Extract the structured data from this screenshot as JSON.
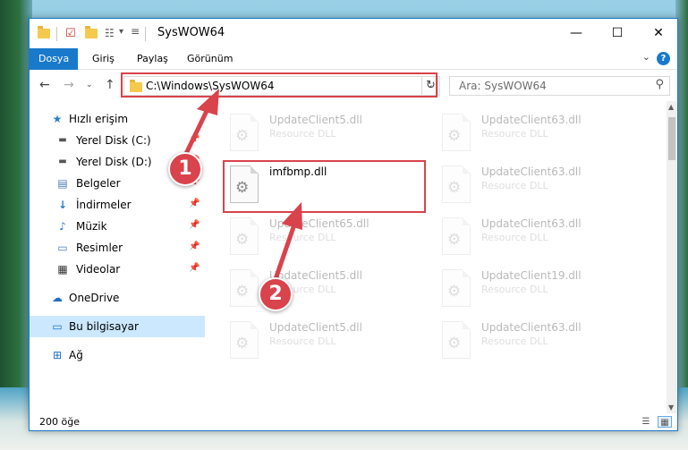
{
  "window": {
    "title": "SysWOW64",
    "controls": {
      "minimize": "—",
      "maximize": "☐",
      "close": "✕"
    }
  },
  "quick_access_toolbar": {
    "dropdown": "▾"
  },
  "ribbon": {
    "tabs": [
      {
        "label": "Dosya",
        "active": true
      },
      {
        "label": "Giriş"
      },
      {
        "label": "Paylaş"
      },
      {
        "label": "Görünüm"
      }
    ],
    "help": "?"
  },
  "address_bar": {
    "path": "C:\\Windows\\SysWOW64",
    "search_placeholder": "Ara: SysWOW64"
  },
  "sidebar": {
    "items": [
      {
        "label": "Hızlı erişim",
        "icon": "star-icon"
      },
      {
        "label": "Yerel Disk (C:)",
        "icon": "drive-icon",
        "pinned": true
      },
      {
        "label": "Yerel Disk (D:)",
        "icon": "drive-icon",
        "pinned": true
      },
      {
        "label": "Belgeler",
        "icon": "documents-icon",
        "pinned": true
      },
      {
        "label": "İndirmeler",
        "icon": "download-icon",
        "pinned": true
      },
      {
        "label": "Müzik",
        "icon": "music-icon",
        "pinned": true
      },
      {
        "label": "Resimler",
        "icon": "pictures-icon",
        "pinned": true
      },
      {
        "label": "Videolar",
        "icon": "videos-icon",
        "pinned": true
      },
      {
        "label": "OneDrive",
        "icon": "cloud-icon"
      },
      {
        "label": "Bu bilgisayar",
        "icon": "computer-icon",
        "selected": true
      },
      {
        "label": "Ağ",
        "icon": "network-icon"
      }
    ]
  },
  "files": [
    {
      "name": "UpdateClient5.dll",
      "type": "Resource DLL",
      "faded": true
    },
    {
      "name": "UpdateClient63.dll",
      "type": "Resource DLL",
      "faded": true
    },
    {
      "name": "imfbmp.dll",
      "type": "",
      "faded": false
    },
    {
      "name": "UpdateClient63.dll",
      "type": "Resource DLL",
      "faded": true
    },
    {
      "name": "UpdateClient65.dll",
      "type": "Resource DLL",
      "faded": true
    },
    {
      "name": "UpdateClient63.dll",
      "type": "Resource DLL",
      "faded": true
    },
    {
      "name": "UpdateClient5.dll",
      "type": "Resource DLL",
      "faded": true
    },
    {
      "name": "UpdateClient19.dll",
      "type": "Resource DLL",
      "faded": true
    },
    {
      "name": "UpdateClient5.dll",
      "type": "Resource DLL",
      "faded": true
    },
    {
      "name": "UpdateClient63.dll",
      "type": "Resource DLL",
      "faded": true
    }
  ],
  "status_bar": {
    "item_count": "200 öğe"
  },
  "annotations": {
    "color": "#d9434c",
    "step1": "1",
    "step2": "2"
  }
}
